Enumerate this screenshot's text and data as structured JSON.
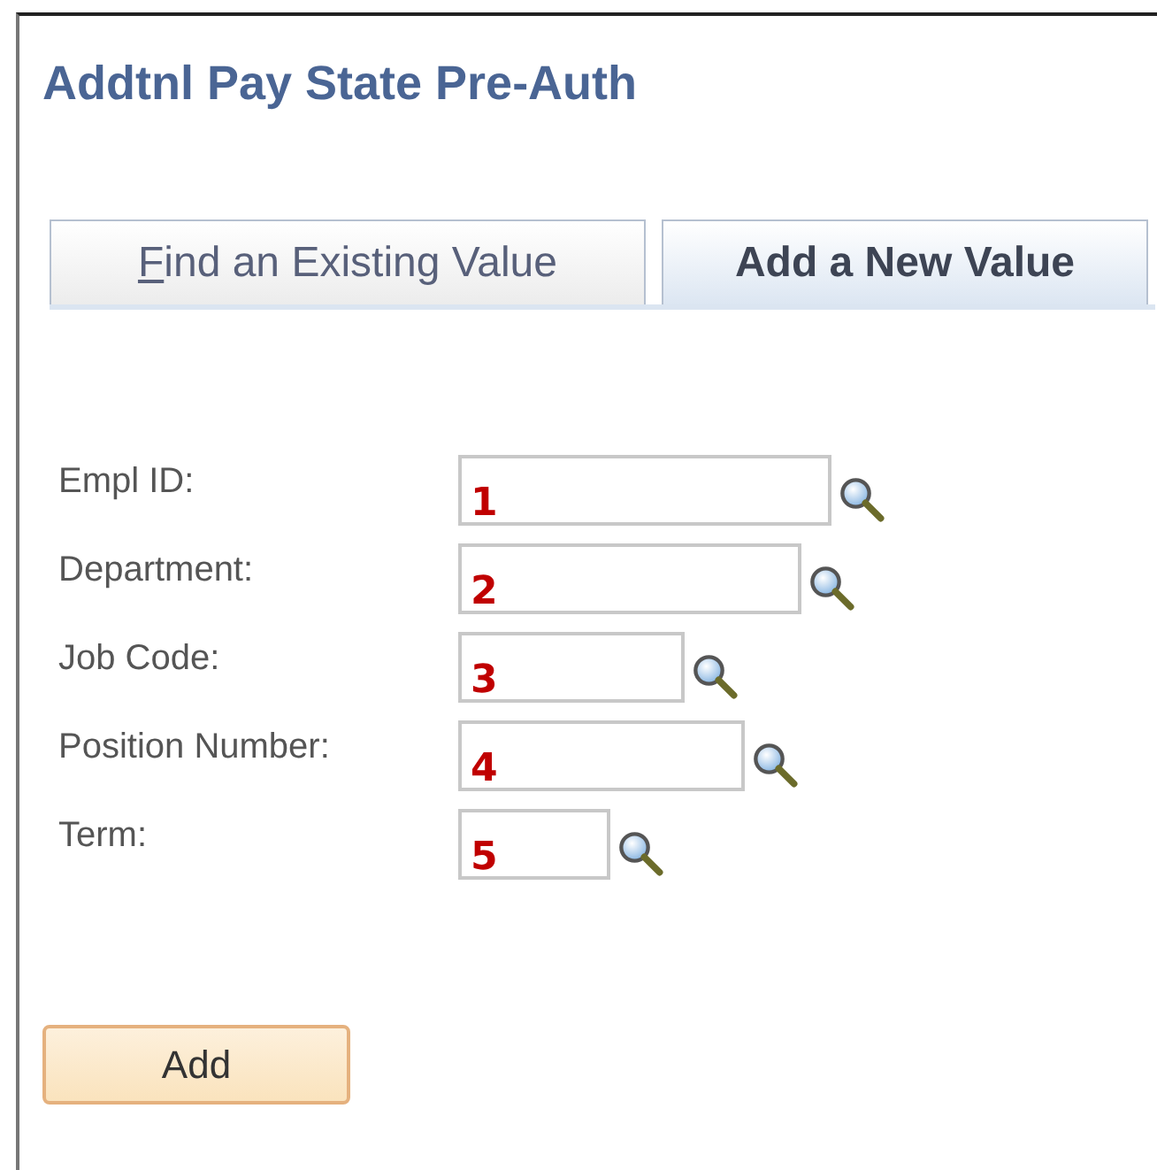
{
  "page": {
    "title": "Addtnl Pay State Pre-Auth"
  },
  "tabs": [
    {
      "label": "Find an Existing Value",
      "selected": false,
      "mnemonic_underline": true
    },
    {
      "label": "Add a New Value",
      "selected": true,
      "mnemonic_underline": false
    }
  ],
  "fields": [
    {
      "label": "Empl ID:",
      "marker": "1"
    },
    {
      "label": "Department:",
      "marker": "2"
    },
    {
      "label": "Job Code:",
      "marker": "3"
    },
    {
      "label": "Position Number:",
      "marker": "4"
    },
    {
      "label": "Term:",
      "marker": "5"
    }
  ],
  "button": {
    "label": "Add"
  }
}
